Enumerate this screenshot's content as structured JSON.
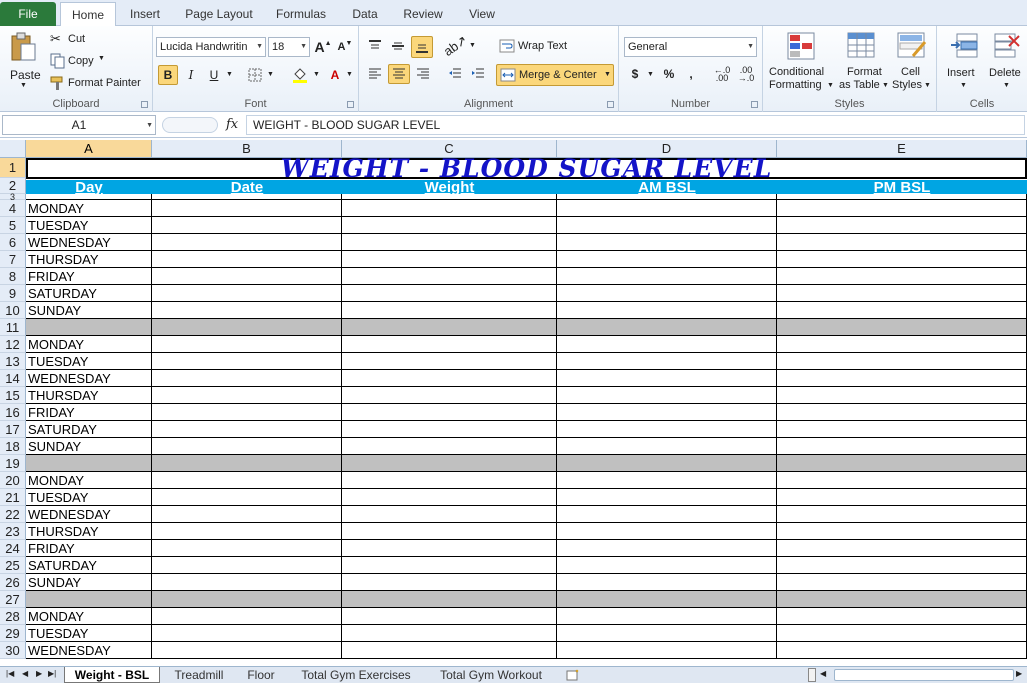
{
  "ribbon_tabs": [
    "File",
    "Home",
    "Insert",
    "Page Layout",
    "Formulas",
    "Data",
    "Review",
    "View"
  ],
  "clipboard": {
    "paste": "Paste",
    "cut": "Cut",
    "copy": "Copy",
    "format_painter": "Format Painter",
    "label": "Clipboard"
  },
  "font": {
    "name": "Lucida Handwritin",
    "size": "18",
    "label": "Font",
    "grow": "A",
    "shrink": "A",
    "bold": "B",
    "italic": "I",
    "underline": "U",
    "color": "A"
  },
  "alignment": {
    "wrap_text": "Wrap Text",
    "merge_center": "Merge & Center",
    "label": "Alignment"
  },
  "number": {
    "format": "General",
    "label": "Number",
    "currency": "$",
    "percent": "%",
    "comma": ",",
    "inc_decimal": ".00",
    "dec_decimal": ".00"
  },
  "styles": {
    "conditional": "Conditional",
    "formatting": "Formatting",
    "format_as": "Format",
    "as_table": "as Table",
    "cell": "Cell",
    "cell_styles": "Styles",
    "label": "Styles"
  },
  "cells": {
    "insert": "Insert",
    "delete": "Delete",
    "label": "Cells"
  },
  "formula_bar": {
    "name_box": "A1",
    "fx": "fx",
    "content": "WEIGHT - BLOOD SUGAR LEVEL"
  },
  "columns": [
    "A",
    "B",
    "C",
    "D",
    "E"
  ],
  "title": "WEIGHT - BLOOD SUGAR LEVEL",
  "headers": [
    "Day",
    "Date",
    "Weight",
    "AM BSL",
    "PM BSL"
  ],
  "rows": [
    {
      "n": "1"
    },
    {
      "n": "2"
    },
    {
      "n": "3",
      "day": ""
    },
    {
      "n": "4",
      "day": "MONDAY"
    },
    {
      "n": "5",
      "day": "TUESDAY"
    },
    {
      "n": "6",
      "day": "WEDNESDAY"
    },
    {
      "n": "7",
      "day": "THURSDAY"
    },
    {
      "n": "8",
      "day": "FRIDAY"
    },
    {
      "n": "9",
      "day": "SATURDAY"
    },
    {
      "n": "10",
      "day": "SUNDAY"
    },
    {
      "n": "11",
      "day": "",
      "sep": true
    },
    {
      "n": "12",
      "day": "MONDAY"
    },
    {
      "n": "13",
      "day": "TUESDAY"
    },
    {
      "n": "14",
      "day": "WEDNESDAY"
    },
    {
      "n": "15",
      "day": "THURSDAY"
    },
    {
      "n": "16",
      "day": "FRIDAY"
    },
    {
      "n": "17",
      "day": "SATURDAY"
    },
    {
      "n": "18",
      "day": "SUNDAY"
    },
    {
      "n": "19",
      "day": "",
      "sep": true
    },
    {
      "n": "20",
      "day": "MONDAY"
    },
    {
      "n": "21",
      "day": "TUESDAY"
    },
    {
      "n": "22",
      "day": "WEDNESDAY"
    },
    {
      "n": "23",
      "day": "THURSDAY"
    },
    {
      "n": "24",
      "day": "FRIDAY"
    },
    {
      "n": "25",
      "day": "SATURDAY"
    },
    {
      "n": "26",
      "day": "SUNDAY"
    },
    {
      "n": "27",
      "day": "",
      "sep": true
    },
    {
      "n": "28",
      "day": "MONDAY"
    },
    {
      "n": "29",
      "day": "TUESDAY"
    },
    {
      "n": "30",
      "day": "WEDNESDAY"
    }
  ],
  "sheet_tabs": [
    "Weight - BSL",
    "Treadmill",
    "Floor",
    "Total Gym Exercises",
    "Total Gym Workout"
  ],
  "colors": {
    "header_fill": "#00a5e3",
    "title_text": "#1414c8",
    "separator": "#c0c0c0",
    "file_tab": "#2b7a3b"
  }
}
